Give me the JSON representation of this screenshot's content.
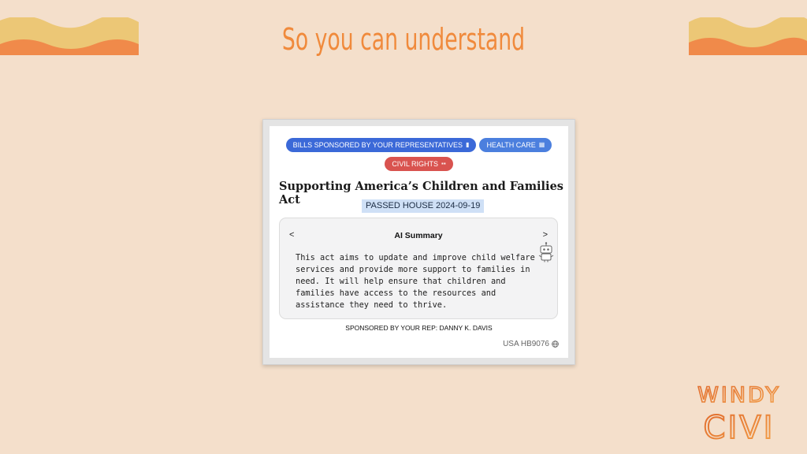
{
  "slide": {
    "headline": "So you can understand"
  },
  "card": {
    "tags": [
      {
        "label": "BILLS SPONSORED BY YOUR REPRESENTATIVES",
        "icon": "flag-icon",
        "color": "#3b69d8"
      },
      {
        "label": "HEALTH CARE",
        "icon": "hospital-icon",
        "color": "#4b7fde"
      },
      {
        "label": "CIVIL RIGHTS",
        "icon": "people-icon",
        "color": "#d9534f"
      }
    ],
    "title": "Supporting America’s Children and Families Act",
    "status": "PASSED HOUSE 2024-09-19",
    "summary": {
      "prev_label": "<",
      "next_label": ">",
      "heading": "AI Summary",
      "text": "This act aims to update and improve child welfare services and provide more support to families in need. It will help ensure that children and families have access to the resources and assistance they need to thrive."
    },
    "sponsor": "SPONSORED BY YOUR REP: DANNY K. DAVIS",
    "bill_id": "USA HB9076"
  },
  "logo": {
    "line1": "WINDY",
    "line2": "CIVI"
  },
  "colors": {
    "background": "#f4dfcb",
    "accent": "#f08a3c",
    "wave_yellow": "#ecc776",
    "wave_orange": "#f08a4a"
  }
}
